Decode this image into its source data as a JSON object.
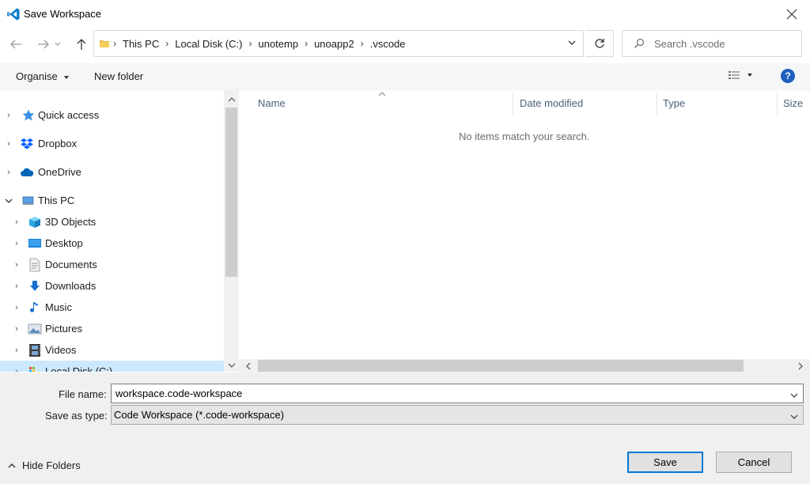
{
  "window": {
    "title": "Save Workspace"
  },
  "address": {
    "crumbs": [
      "This PC",
      "Local Disk (C:)",
      "unotemp",
      "unoapp2",
      ".vscode"
    ]
  },
  "search": {
    "placeholder": "Search .vscode"
  },
  "toolbar": {
    "organise_label": "Organise",
    "new_folder_label": "New folder"
  },
  "navigation": {
    "items": [
      {
        "label": "Quick access",
        "icon": "star-icon",
        "expanded": false
      },
      {
        "label": "Dropbox",
        "icon": "dropbox-icon",
        "expanded": false
      },
      {
        "label": "OneDrive",
        "icon": "cloud-icon",
        "expanded": false
      },
      {
        "label": "This PC",
        "icon": "computer-icon",
        "expanded": true
      },
      {
        "label": "3D Objects",
        "icon": "cube-icon",
        "expanded": false
      },
      {
        "label": "Desktop",
        "icon": "desktop-icon",
        "expanded": false
      },
      {
        "label": "Documents",
        "icon": "document-icon",
        "expanded": false
      },
      {
        "label": "Downloads",
        "icon": "download-icon",
        "expanded": false
      },
      {
        "label": "Music",
        "icon": "music-note-icon",
        "expanded": false
      },
      {
        "label": "Pictures",
        "icon": "picture-icon",
        "expanded": false
      },
      {
        "label": "Videos",
        "icon": "film-icon",
        "expanded": false
      },
      {
        "label": "Local Disk (C:)",
        "icon": "drive-icon",
        "expanded": false,
        "selected": true
      }
    ]
  },
  "file_list": {
    "columns": [
      "Name",
      "Date modified",
      "Type",
      "Size"
    ],
    "empty_message": "No items match your search."
  },
  "form": {
    "file_name_label": "File name:",
    "file_name_value": "workspace.code-workspace",
    "save_type_label": "Save as type:",
    "save_type_value": "Code Workspace (*.code-workspace)"
  },
  "footer": {
    "hide_folders_label": "Hide Folders",
    "save_label": "Save",
    "cancel_label": "Cancel"
  },
  "colors": {
    "accent": "#0078d7",
    "selection": "#cce8ff",
    "help": "#1e5fbf",
    "vscode_blue": "#0a7acc"
  }
}
